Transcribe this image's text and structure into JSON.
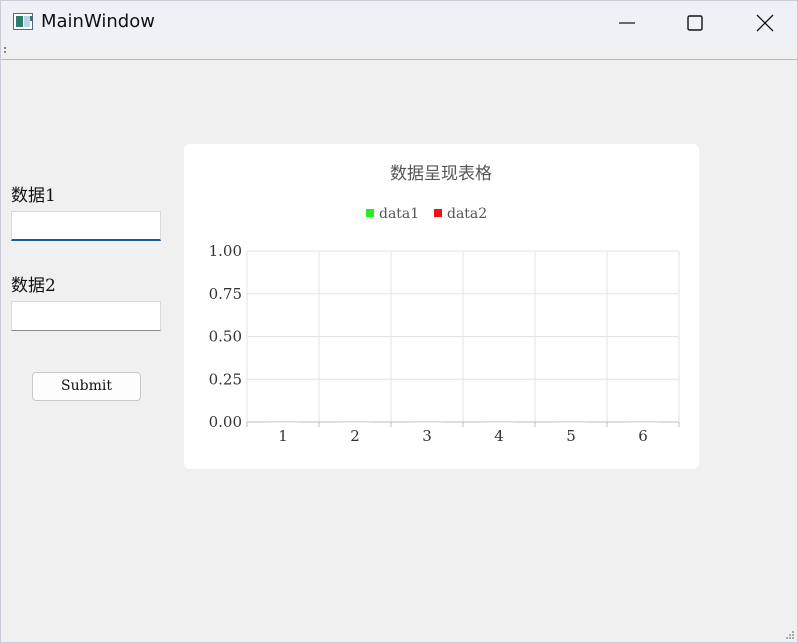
{
  "window": {
    "title": "MainWindow"
  },
  "form": {
    "field1_label": "数据1",
    "field1_value": "",
    "field2_label": "数据2",
    "field2_value": "",
    "submit_label": "Submit"
  },
  "chart_data": {
    "type": "bar",
    "title": "数据呈现表格",
    "categories": [
      "1",
      "2",
      "3",
      "4",
      "5",
      "6"
    ],
    "series": [
      {
        "name": "data1",
        "color": "#22ee22",
        "values": [
          0,
          0,
          0,
          0,
          0,
          0
        ]
      },
      {
        "name": "data2",
        "color": "#ee1111",
        "values": [
          0,
          0,
          0,
          0,
          0,
          0
        ]
      }
    ],
    "ylim": [
      0,
      1
    ],
    "yticks": [
      "0.00",
      "0.25",
      "0.50",
      "0.75",
      "1.00"
    ],
    "xlabel": "",
    "ylabel": "",
    "grid": true,
    "legend": "top-center"
  }
}
